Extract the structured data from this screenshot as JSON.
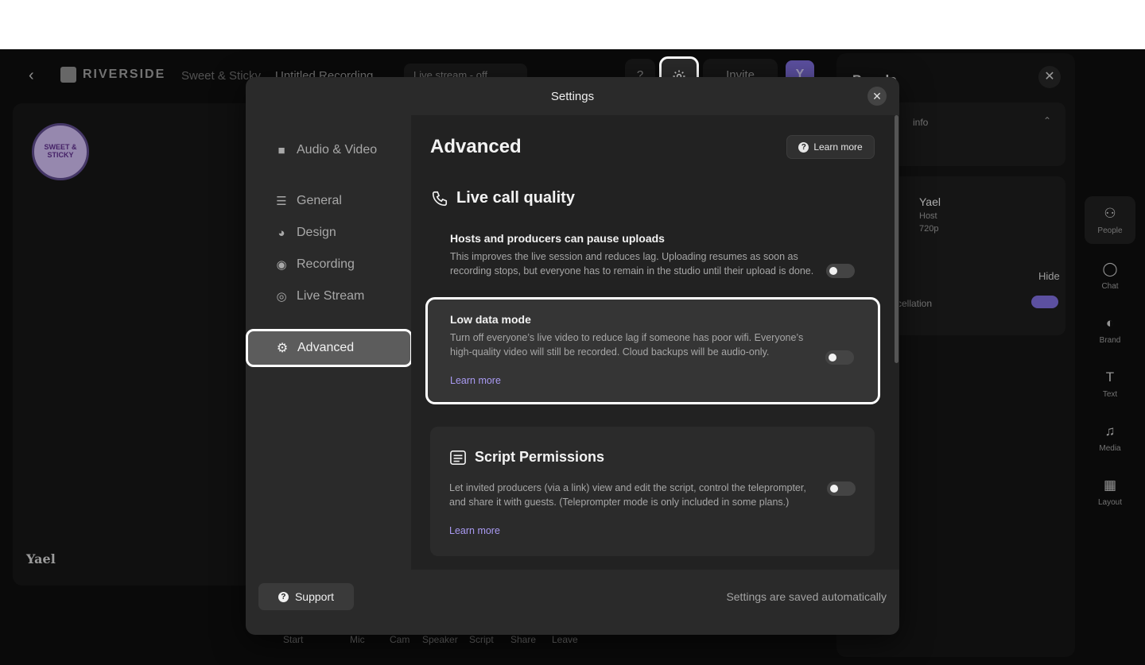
{
  "app": {
    "back_glyph": "‹",
    "logo_text": "RIVERSIDE",
    "breadcrumb_studio": "Sweet & Sticky",
    "breadcrumb_recording": "Untitled Recording",
    "live_stream_pill": "Live stream - off",
    "invite_label": "Invite",
    "avatar_initial": "Y",
    "help_glyph": "?",
    "stage_participant_name": "Yael",
    "sticker_text": "SWEET & STICKY",
    "controls": [
      "Start",
      "Mic",
      "Cam",
      "Speaker",
      "Script",
      "Share",
      "Leave"
    ]
  },
  "people_panel": {
    "title": "People",
    "session_info_label": "info",
    "participant_name": "Yael",
    "participant_role": "Host",
    "participant_resolution": "720p",
    "hide_label": "Hide",
    "noise_label": "cellation"
  },
  "rail": {
    "items": [
      {
        "label": "People",
        "icon": "people-icon"
      },
      {
        "label": "Chat",
        "icon": "chat-icon"
      },
      {
        "label": "Brand",
        "icon": "palette-icon"
      },
      {
        "label": "Text",
        "icon": "text-icon"
      },
      {
        "label": "Media",
        "icon": "music-icon"
      },
      {
        "label": "Layout",
        "icon": "grid-icon"
      }
    ]
  },
  "settings": {
    "title": "Settings",
    "close_glyph": "✕",
    "nav": [
      {
        "label": "Audio & Video",
        "icon": "camera-icon"
      },
      {
        "label": "General",
        "icon": "sliders-icon"
      },
      {
        "label": "Design",
        "icon": "palette-icon"
      },
      {
        "label": "Recording",
        "icon": "record-icon"
      },
      {
        "label": "Live Stream",
        "icon": "broadcast-icon"
      },
      {
        "label": "Advanced",
        "icon": "gear-icon"
      }
    ],
    "active_nav": "Advanced",
    "page_title": "Advanced",
    "learn_more_button": "Learn more",
    "live_call_section": "Live call quality",
    "options": [
      {
        "title": "Hosts and producers can pause uploads",
        "description": "This improves the live session and reduces lag. Uploading resumes as soon as recording stops, but everyone has to remain in the studio until their upload is done.",
        "enabled": false
      },
      {
        "title": "Low data mode",
        "description": "Turn off everyone’s live video to reduce lag if someone has poor wifi. Everyone’s high-quality video will still be recorded. Cloud backups will be audio-only.",
        "link": "Learn more",
        "enabled": false
      }
    ],
    "script_section": {
      "title": "Script Permissions",
      "description": "Let invited producers (via a link) view and edit the script, control the teleprompter, and share it with guests. (Teleprompter mode is only included in some plans.)",
      "link": "Learn more",
      "enabled": false
    },
    "support_label": "Support",
    "saved_note": "Settings are saved automatically"
  },
  "colors": {
    "accent": "#a99af2",
    "modal_bg": "#2a2a2a",
    "highlight_border": "#ffffff"
  }
}
